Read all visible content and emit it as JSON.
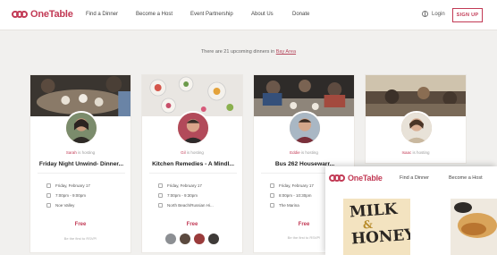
{
  "brand": {
    "name": "OneTable",
    "color": "#c23a55"
  },
  "nav": {
    "links": [
      "Find a Dinner",
      "Become a Host",
      "Event Partnership",
      "About Us",
      "Donate"
    ],
    "login": "Login",
    "signup": "SIGN UP",
    "icons": {
      "language": "globe-icon"
    }
  },
  "banner": {
    "prefix": "There are 21 upcoming dinners in",
    "location": "Bay Area"
  },
  "cards": [
    {
      "host_name": "Sarah",
      "host_suffix": "is hosting",
      "title": "Friday Night Unwind- Dinner...",
      "date": "Friday, February 17",
      "time": "7:00pm - 9:00pm",
      "location": "Noe Valley",
      "price": "Free",
      "footnote": "Be the first to RSVP!"
    },
    {
      "host_name": "Gil",
      "host_suffix": "is hosting",
      "title": "Kitchen Remedies - A Mindl...",
      "date": "Friday, February 17",
      "time": "7:00pm - 9:30pm",
      "location": "North Beach/Russian Hi...",
      "price": "Free",
      "footnote": ""
    },
    {
      "host_name": "Eddie",
      "host_suffix": "is hosting",
      "title": "Bus 262 Housewarr...",
      "date": "Friday, February 17",
      "time": "8:00pm - 10:30pm",
      "location": "The Marina",
      "price": "Free",
      "footnote": "Be the first to RSVP!"
    },
    {
      "host_name": "Isaac",
      "host_suffix": "is hosting",
      "title": "",
      "date": "",
      "time": "",
      "location": "",
      "price": "",
      "footnote": ""
    }
  ],
  "inset": {
    "brand": "OneTable",
    "links": [
      "Find a Dinner",
      "Become a Host"
    ],
    "poster_line1": "MILK",
    "poster_line2": "&",
    "poster_line3": "HONEY"
  }
}
